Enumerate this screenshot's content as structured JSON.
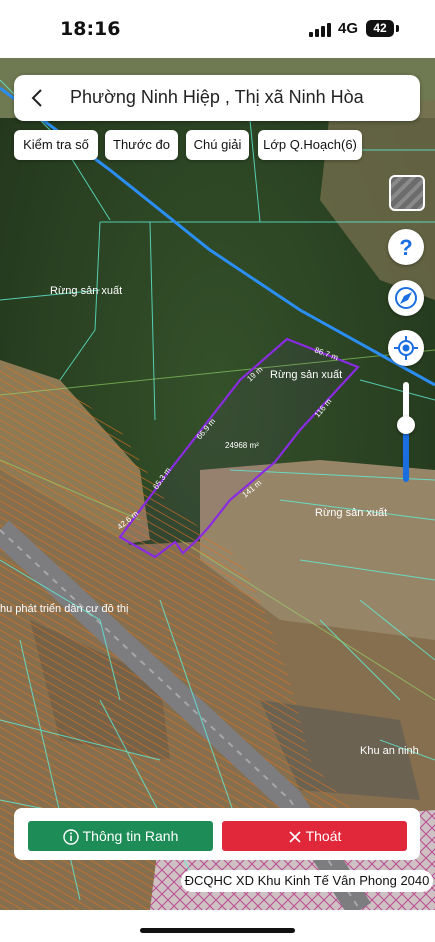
{
  "status_bar": {
    "time": "18:16",
    "network": "4G",
    "battery": "42"
  },
  "header": {
    "title": "Phường Ninh Hiệp , Thị xã Ninh Hòa"
  },
  "toolbar": {
    "check_label": "Kiểm tra số",
    "measure_label": "Thước đo",
    "legend_label": "Chú giải",
    "layer_label": "Lớp Q.Hoạch(6)"
  },
  "map": {
    "labels": {
      "forest_1": "Rừng sản xuất",
      "forest_2": "Rừng sản xuất",
      "forest_3": "Rừng sản xuất",
      "urban": "hu phát triển dân cư đô thị",
      "security": "Khu an ninh"
    },
    "parcel": {
      "area": "24968 m²",
      "edges": [
        "86.7 m",
        "19 m",
        "66.9 m",
        "65.3 m",
        "42.6 m",
        "141 m",
        "116 m"
      ]
    }
  },
  "controls": {
    "help_icon": "question-icon",
    "compass_icon": "compass-icon",
    "locate_icon": "locate-icon",
    "zoom_level": 0.58
  },
  "actions": {
    "info_label": "Thông tin Ranh",
    "exit_label": "Thoát"
  },
  "footer": {
    "caption": "ĐCQHC XD Khu Kinh Tế Vân Phong 2040"
  },
  "colors": {
    "accent": "#1b6ee0",
    "parcel": "#8a2be2",
    "info": "#1d8c57",
    "exit": "#e0283a",
    "zone_hatch": "#d8641a"
  }
}
